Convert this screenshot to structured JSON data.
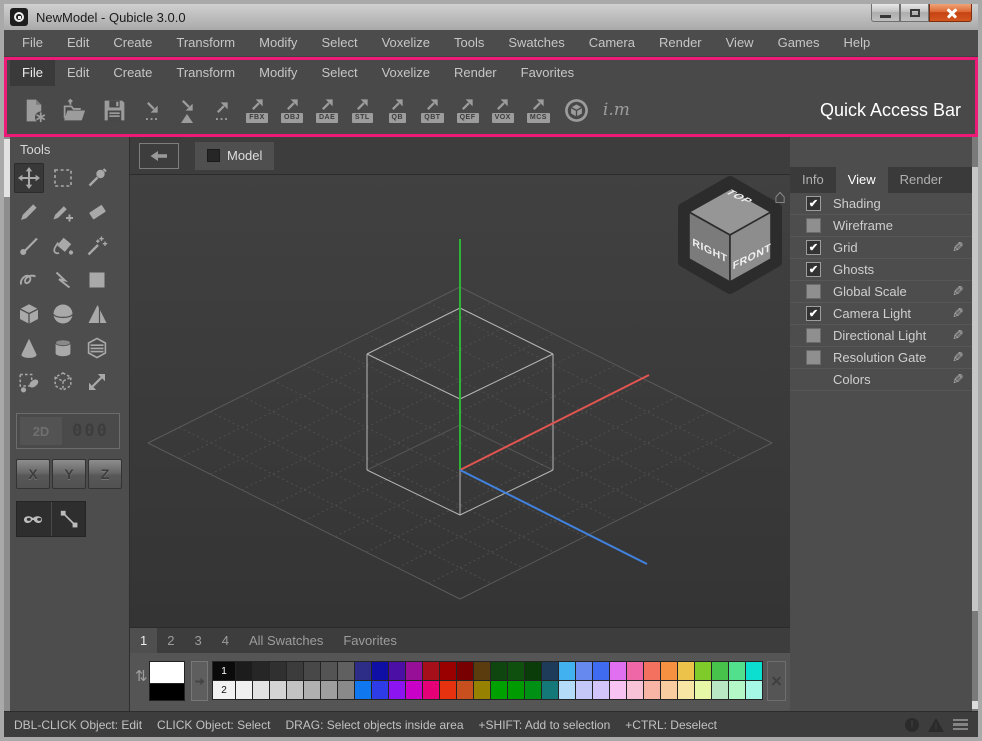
{
  "window": {
    "title": "NewModel - Qubicle 3.0.0"
  },
  "colors": {
    "accent_highlight": "#ed1a78",
    "axis_x_red": "#e05550",
    "axis_y_green": "#2eb438",
    "axis_z_blue": "#4082dd",
    "wireframe": "#cccccc"
  },
  "menubar": {
    "items": [
      "File",
      "Edit",
      "Create",
      "Transform",
      "Modify",
      "Select",
      "Voxelize",
      "Tools",
      "Swatches",
      "Camera",
      "Render",
      "View",
      "Games",
      "Help"
    ]
  },
  "quick_access_bar": {
    "annotation": "Quick Access Bar",
    "menu": {
      "items": [
        "File",
        "Edit",
        "Create",
        "Transform",
        "Modify",
        "Select",
        "Voxelize",
        "Render",
        "Favorites"
      ],
      "active": "File"
    },
    "buttons": [
      {
        "name": "new-model-button",
        "icon": "new-file"
      },
      {
        "name": "open-button",
        "icon": "open-folder"
      },
      {
        "name": "save-button",
        "icon": "save-floppy"
      },
      {
        "name": "import-button",
        "icon": "import-arrow",
        "sub": "..."
      },
      {
        "name": "import-mesh-button",
        "icon": "import-mesh"
      },
      {
        "name": "export-button",
        "icon": "export-arrow",
        "sub": "..."
      },
      {
        "name": "export-fbx-button",
        "icon": "export-arrow",
        "sub": "FBX"
      },
      {
        "name": "export-obj-button",
        "icon": "export-arrow",
        "sub": "OBJ"
      },
      {
        "name": "export-dae-button",
        "icon": "export-arrow",
        "sub": "DAE"
      },
      {
        "name": "export-stl-button",
        "icon": "export-arrow",
        "sub": "STL"
      },
      {
        "name": "export-qb-button",
        "icon": "export-arrow",
        "sub": "QB"
      },
      {
        "name": "export-qbt-button",
        "icon": "export-arrow",
        "sub": "QBT"
      },
      {
        "name": "export-qef-button",
        "icon": "export-arrow",
        "sub": "QEF"
      },
      {
        "name": "export-vox-button",
        "icon": "export-arrow",
        "sub": "VOX"
      },
      {
        "name": "export-mcs-button",
        "icon": "export-arrow",
        "sub": "MCS"
      },
      {
        "name": "sketchfab-button",
        "icon": "sketchfab"
      },
      {
        "name": "imaterialise-button",
        "icon": "im-logo",
        "sub": "i.m"
      }
    ]
  },
  "tools_panel": {
    "title": "Tools",
    "active_tool": "move-tool",
    "tools": [
      {
        "name": "move-tool",
        "icon": "move"
      },
      {
        "name": "rect-select-tool",
        "icon": "rect-select"
      },
      {
        "name": "color-picker-tool",
        "icon": "color-picker"
      },
      {
        "name": "pencil-tool",
        "icon": "pencil"
      },
      {
        "name": "pencil-add-tool",
        "icon": "pencil-add"
      },
      {
        "name": "eraser-tool",
        "icon": "eraser"
      },
      {
        "name": "brush-tool",
        "icon": "brush"
      },
      {
        "name": "paint-bucket-tool",
        "icon": "paint-bucket"
      },
      {
        "name": "magic-wand-tool",
        "icon": "magic-wand"
      },
      {
        "name": "freehand-tool",
        "icon": "freehand"
      },
      {
        "name": "polyline-tool",
        "icon": "polyline"
      },
      {
        "name": "rectangle-tool",
        "icon": "rectangle"
      },
      {
        "name": "box-tool",
        "icon": "box"
      },
      {
        "name": "sphere-tool",
        "icon": "sphere"
      },
      {
        "name": "pyramid-tool",
        "icon": "pyramid"
      },
      {
        "name": "cone-tool",
        "icon": "cone"
      },
      {
        "name": "cylinder-tool",
        "icon": "cylinder"
      },
      {
        "name": "extrude-tool",
        "icon": "extrude"
      },
      {
        "name": "select-brush-tool",
        "icon": "select-brush"
      },
      {
        "name": "select-box-tool",
        "icon": "select-box"
      },
      {
        "name": "scale-tool",
        "icon": "scale"
      }
    ],
    "display_2d_label": "2D",
    "counter_value": "000",
    "axis_buttons": [
      "X",
      "Y",
      "Z"
    ],
    "extra_tools": [
      {
        "name": "mask-tool",
        "icon": "mask"
      },
      {
        "name": "line-tool",
        "icon": "line"
      }
    ]
  },
  "viewport": {
    "tab_label": "Model",
    "orientation_cube": {
      "top_label": "TOP",
      "left_label": "RIGHT",
      "right_label": "FRONT"
    }
  },
  "right_panel": {
    "tabs": [
      "Info",
      "View",
      "Render"
    ],
    "active_tab": "View",
    "rows": [
      {
        "label": "Shading",
        "checkbox": true,
        "checked": true,
        "editable": false
      },
      {
        "label": "Wireframe",
        "checkbox": true,
        "checked": false,
        "editable": false
      },
      {
        "label": "Grid",
        "checkbox": true,
        "checked": true,
        "editable": true
      },
      {
        "label": "Ghosts",
        "checkbox": true,
        "checked": true,
        "editable": false
      },
      {
        "label": "Global Scale",
        "checkbox": true,
        "checked": false,
        "editable": true
      },
      {
        "label": "Camera Light",
        "checkbox": true,
        "checked": true,
        "editable": true
      },
      {
        "label": "Directional Light",
        "checkbox": true,
        "checked": false,
        "editable": true
      },
      {
        "label": "Resolution Gate",
        "checkbox": true,
        "checked": false,
        "editable": true
      },
      {
        "label": "Colors",
        "checkbox": false,
        "checked": false,
        "editable": true
      }
    ]
  },
  "swatches_panel": {
    "tabs": [
      "1",
      "2",
      "3",
      "4",
      "All Swatches",
      "Favorites"
    ],
    "active_tab": "1",
    "foreground_color": "#ffffff",
    "background_color": "#000000",
    "row1_label": "1",
    "row2_label": "2",
    "row1_colors": [
      "#1c1c1c",
      "#262626",
      "#303030",
      "#3c3c3c",
      "#484848",
      "#545454",
      "#606060",
      "#2d2d87",
      "#0f0fa5",
      "#4b0fa5",
      "#960f96",
      "#a50f19",
      "#9b0000",
      "#780000",
      "#5a3c0f",
      "#0f460f",
      "#0f500f",
      "#0a3c0a",
      "#1e3c5a",
      "#41b1f0",
      "#6689f0",
      "#3f6bf0",
      "#e070f0",
      "#f067a8",
      "#f4705f",
      "#f79142",
      "#ecc24a",
      "#7ecb29",
      "#47c24a",
      "#52e08c",
      "#0cdfcf"
    ],
    "row2_colors": [
      "#f0f0f0",
      "#e2e2e2",
      "#d4d4d4",
      "#c2c2c2",
      "#b0b0b0",
      "#9e9e9e",
      "#8a8a8a",
      "#0f78f0",
      "#2d3ce6",
      "#8c14f0",
      "#c800c8",
      "#e60078",
      "#e6320f",
      "#c8501e",
      "#968200",
      "#00a000",
      "#009b00",
      "#009114",
      "#147878",
      "#b4dcf8",
      "#c3c8f8",
      "#d2c3f8",
      "#f8c3f3",
      "#f8c3d7",
      "#f8b4a5",
      "#f8cda0",
      "#f8e6a5",
      "#e6f8a5",
      "#b9e6c3",
      "#b4f8c8",
      "#a5f8e6"
    ]
  },
  "status_bar": {
    "segments": [
      "DBL-CLICK Object: Edit",
      "CLICK Object: Select",
      "DRAG: Select objects inside area",
      "+SHIFT: Add to selection",
      "+CTRL: Deselect"
    ]
  }
}
